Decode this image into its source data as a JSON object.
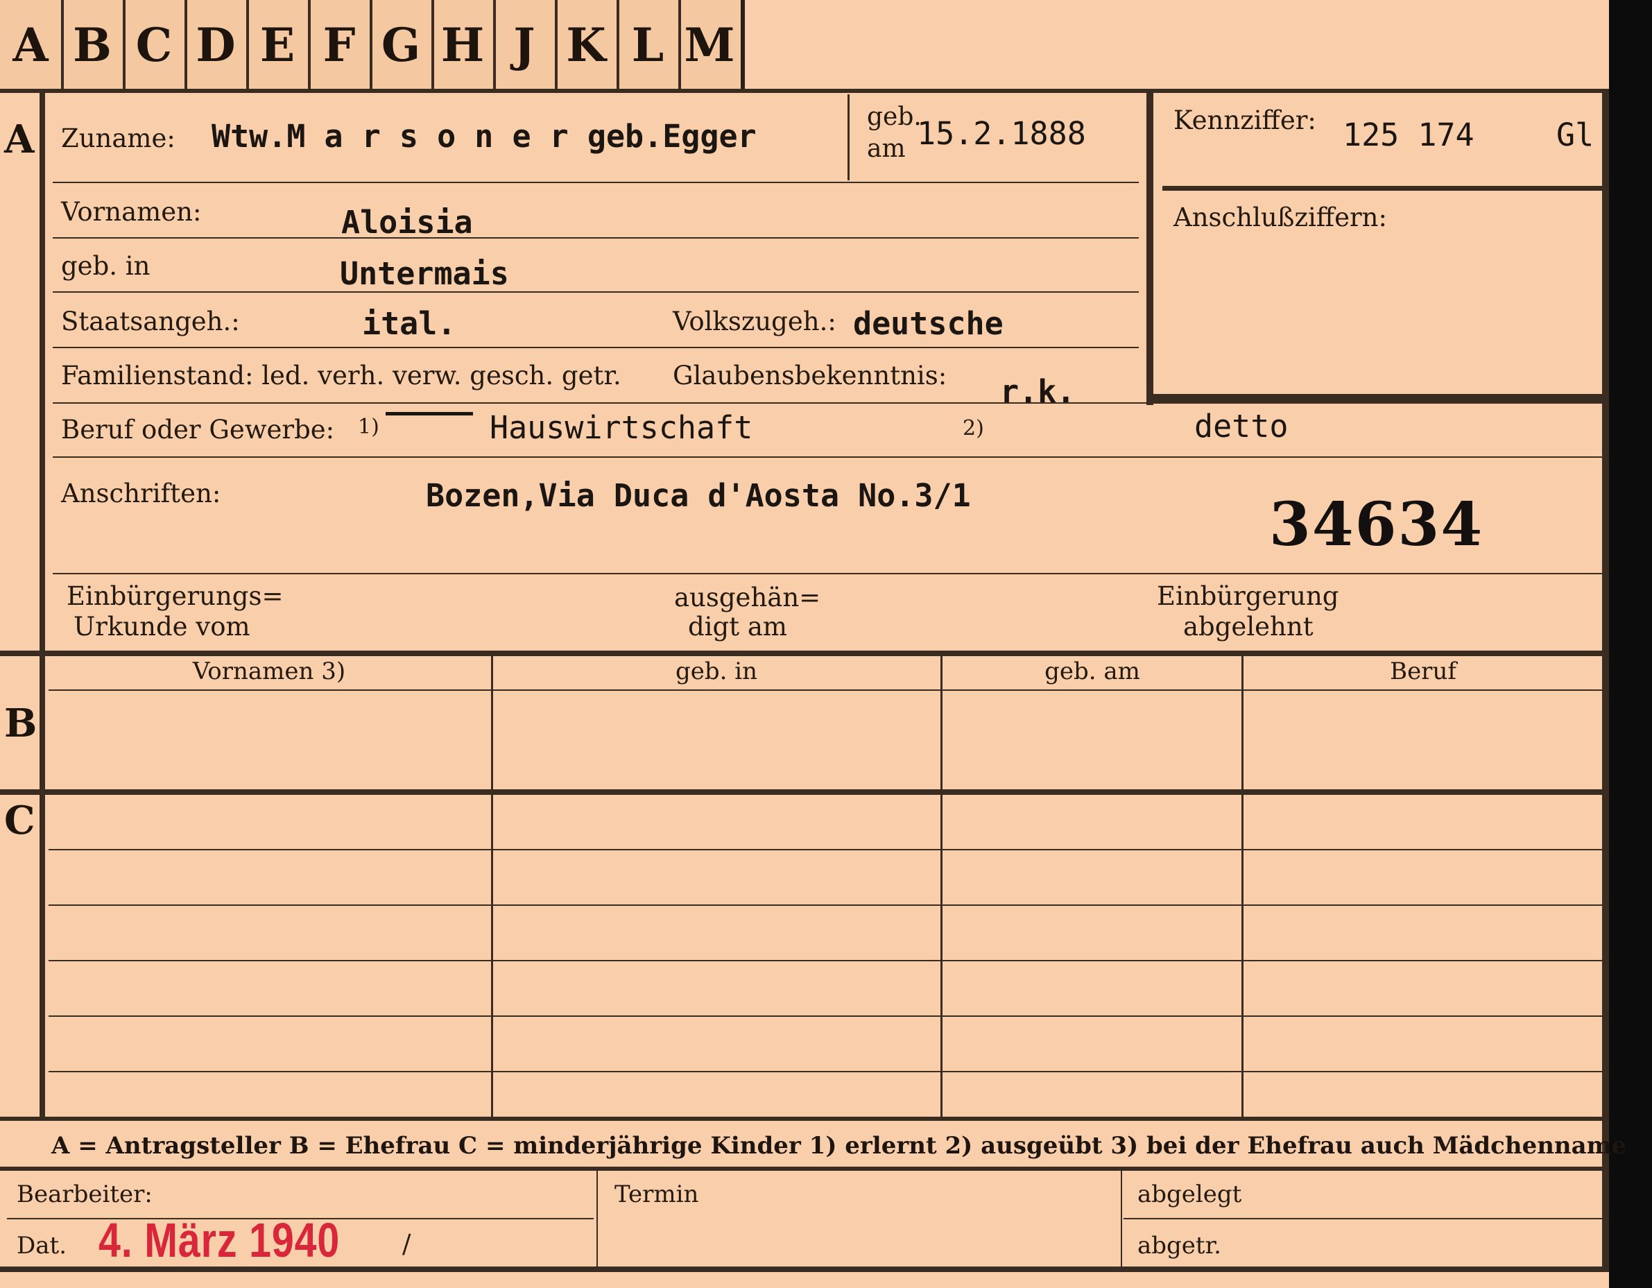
{
  "tabs": [
    "A",
    "B",
    "C",
    "D",
    "E",
    "F",
    "G",
    "H",
    "J",
    "K",
    "L",
    "M"
  ],
  "sections": {
    "a": "A",
    "b": "B",
    "c": "C"
  },
  "fields": {
    "zuname_label": "Zuname:",
    "zuname_value": "Wtw.M a r s o n e r geb.Egger",
    "geb_am_label_1": "geb.",
    "geb_am_label_2": "am",
    "geb_am_value": "15.2.1888",
    "kennziffer_label": "Kennziffer:",
    "kennziffer_value": "125 174",
    "kennziffer_suffix": "Gl",
    "anschluss_label": "Anschlußziffern:",
    "vornamen_label": "Vornamen:",
    "vornamen_value": "Aloisia",
    "geb_in_label": "geb. in",
    "geb_in_value": "Untermais",
    "staatsangeh_label": "Staatsangeh.:",
    "staatsangeh_value": "ital.",
    "volkszugeh_label": "Volkszugeh.:",
    "volkszugeh_value": "deutsche",
    "familienstand_label": "Familienstand: led. verh. verw. gesch. getr.",
    "glaubens_label": "Glaubensbekenntnis:",
    "glaubens_value": "r.k.",
    "beruf_label": "Beruf oder Gewerbe:",
    "beruf_marker_1": "1)",
    "beruf_value_1": "Hauswirtschaft",
    "beruf_marker_2": "2)",
    "beruf_value_2": "detto",
    "anschriften_label": "Anschriften:",
    "anschriften_value": "Bozen,Via Duca d'Aosta No.3/1",
    "file_number": "34634",
    "einb_urkunde_1": "Einbürgerungs=",
    "einb_urkunde_2": "Urkunde vom",
    "ausgehaendigt_1": "ausgehän=",
    "ausgehaendigt_2": "digt am",
    "einb_abgelehnt_1": "Einbürgerung",
    "einb_abgelehnt_2": "abgelehnt"
  },
  "table": {
    "headers": [
      "Vornamen 3)",
      "geb. in",
      "geb. am",
      "Beruf"
    ]
  },
  "legend": "A = Antragsteller   B = Ehefrau   C = minderjährige Kinder   1) erlernt   2) ausgeübt   3) bei der Ehefrau auch Mädchenname",
  "footer": {
    "bearbeiter_label": "Bearbeiter:",
    "dat_label": "Dat.",
    "date_stamp": "4. März 1940",
    "slash": "/",
    "termin_label": "Termin",
    "abgelegt_label": "abgelegt",
    "abgetr_label": "abgetr."
  },
  "colors": {
    "card": "#f8cfaa",
    "ink": "#3b2c22",
    "stamp": "#d8273a"
  }
}
